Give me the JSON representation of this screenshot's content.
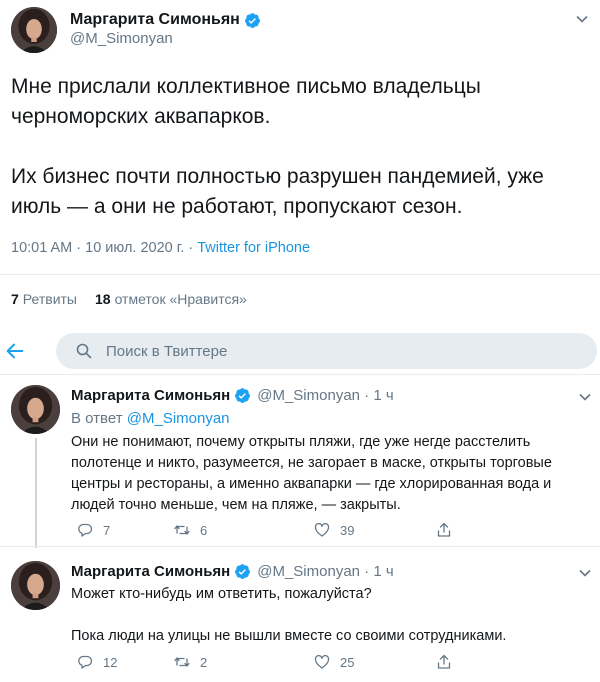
{
  "main_tweet": {
    "author_name": "Маргарита Симоньян",
    "author_handle": "@M_Simonyan",
    "paragraphs": [
      "Мне прислали коллективное письмо владельцы черноморских аквапарков.",
      "Их бизнес почти полностью разрушен пандемией, уже июль — а они не работают, пропускают сезон."
    ],
    "timestamp": "10:01 AM · 10 июл. 2020 г. · ",
    "source": "Twitter for iPhone",
    "retweets_count": "7",
    "retweets_label": "Ретвиты",
    "likes_count": "18",
    "likes_label": "отметок «Нравится»"
  },
  "search": {
    "placeholder": "Поиск в Твиттере"
  },
  "replies": [
    {
      "author_name": "Маргарита Симоньян",
      "handle_time": "@M_Simonyan · 1 ч",
      "reply_to_prefix": "В ответ ",
      "reply_to_handle": "@M_Simonyan",
      "paragraphs": [
        "Они не понимают, почему открыты пляжи, где уже негде расстелить полотенце и никто, разумеется, не загорает в маске, открыты торговые центры и рестораны, а именно аквапарки — где хлорированная вода и людей точно меньше, чем на пляже, — закрыты."
      ],
      "replies_count": "7",
      "retweets_count": "6",
      "likes_count": "39"
    },
    {
      "author_name": "Маргарита Симоньян",
      "handle_time": "@M_Simonyan · 1 ч",
      "paragraphs": [
        "Может кто-нибудь им ответить, пожалуйста?",
        "Пока люди на улицы не вышли вместе со своими сотрудниками."
      ],
      "replies_count": "12",
      "retweets_count": "2",
      "likes_count": "25"
    }
  ],
  "colors": {
    "accent": "#1b95e0",
    "verified": "#1da1f2",
    "secondary_text": "#657786",
    "divider": "#e6ecf0"
  },
  "icons": [
    "verified-badge-icon",
    "chevron-down-icon",
    "back-arrow-icon",
    "search-icon",
    "reply-icon",
    "retweet-icon",
    "like-icon",
    "share-icon"
  ]
}
